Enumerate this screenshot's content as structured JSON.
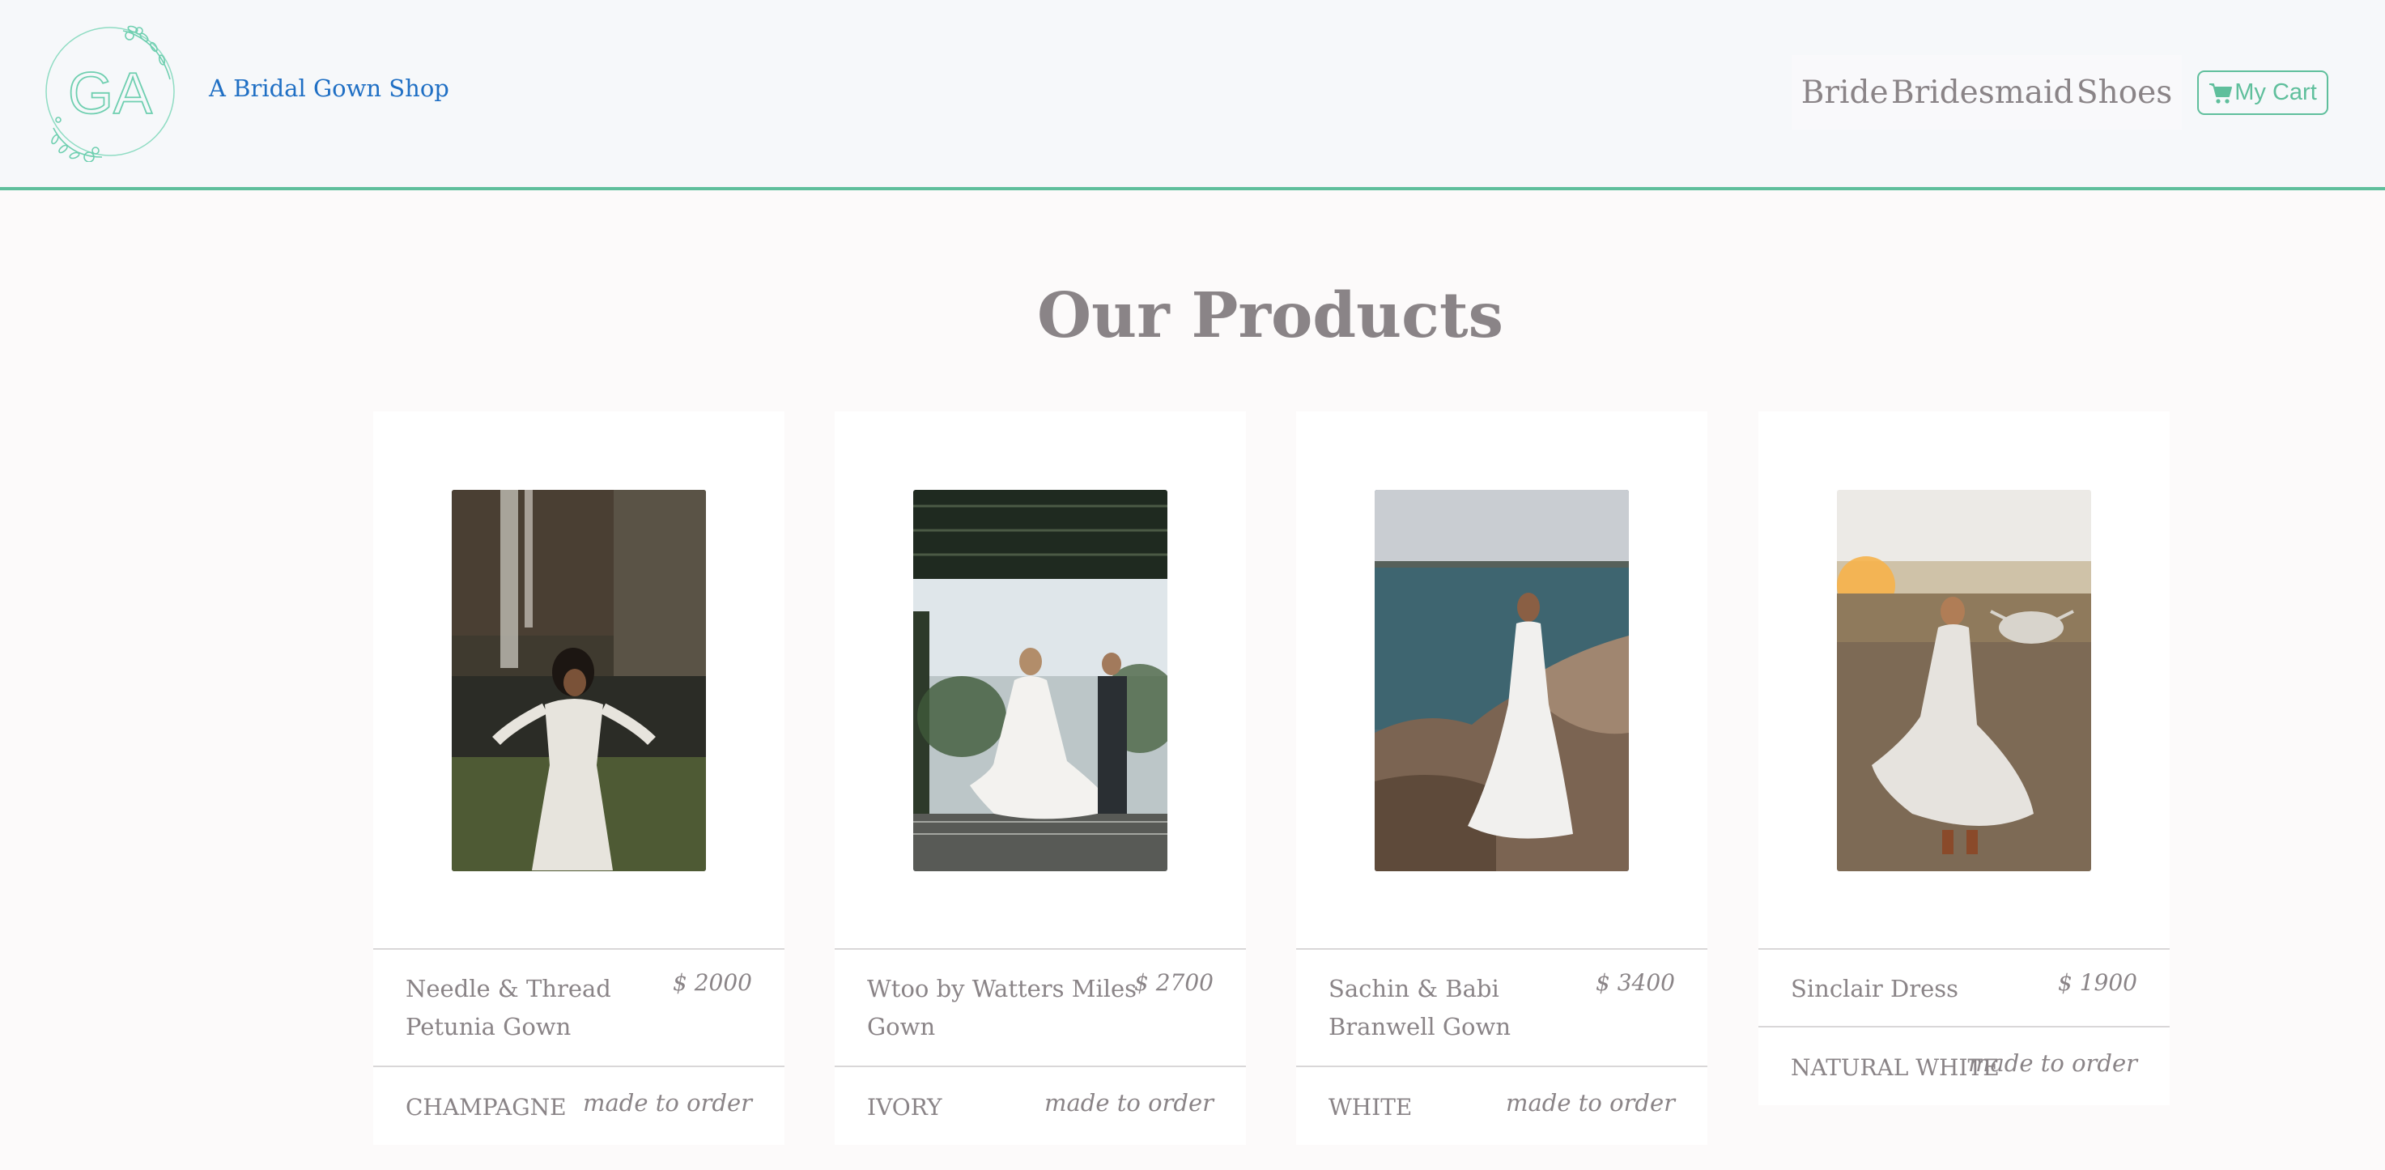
{
  "header": {
    "logo_monogram": "GA",
    "brand_name": "A Bridal Gown Shop",
    "nav": [
      {
        "label": "Bride"
      },
      {
        "label": "Bridesmaid"
      },
      {
        "label": "Shoes"
      }
    ],
    "cart_label": "My Cart",
    "cart_icon": "shopping-cart-icon"
  },
  "colors": {
    "accent": "#5fbf9c",
    "brand_link": "#1f6fc4",
    "text": "#8a8487",
    "header_bg": "#f6f8fa",
    "page_bg": "#fcfafa"
  },
  "main": {
    "title": "Our Products",
    "products": [
      {
        "name": "Needle & Thread Petunia Gown",
        "price": "$ 2000",
        "color": "CHAMPAGNE",
        "availability": "made to order"
      },
      {
        "name": "Wtoo by Watters Miles Gown",
        "price": "$ 2700",
        "color": "IVORY",
        "availability": "made to order"
      },
      {
        "name": "Sachin & Babi Branwell Gown",
        "price": "$ 3400",
        "color": "WHITE",
        "availability": "made to order"
      },
      {
        "name": "Sinclair Dress",
        "price": "$ 1900",
        "color": "NATURAL WHITE",
        "availability": "made to order"
      }
    ]
  }
}
